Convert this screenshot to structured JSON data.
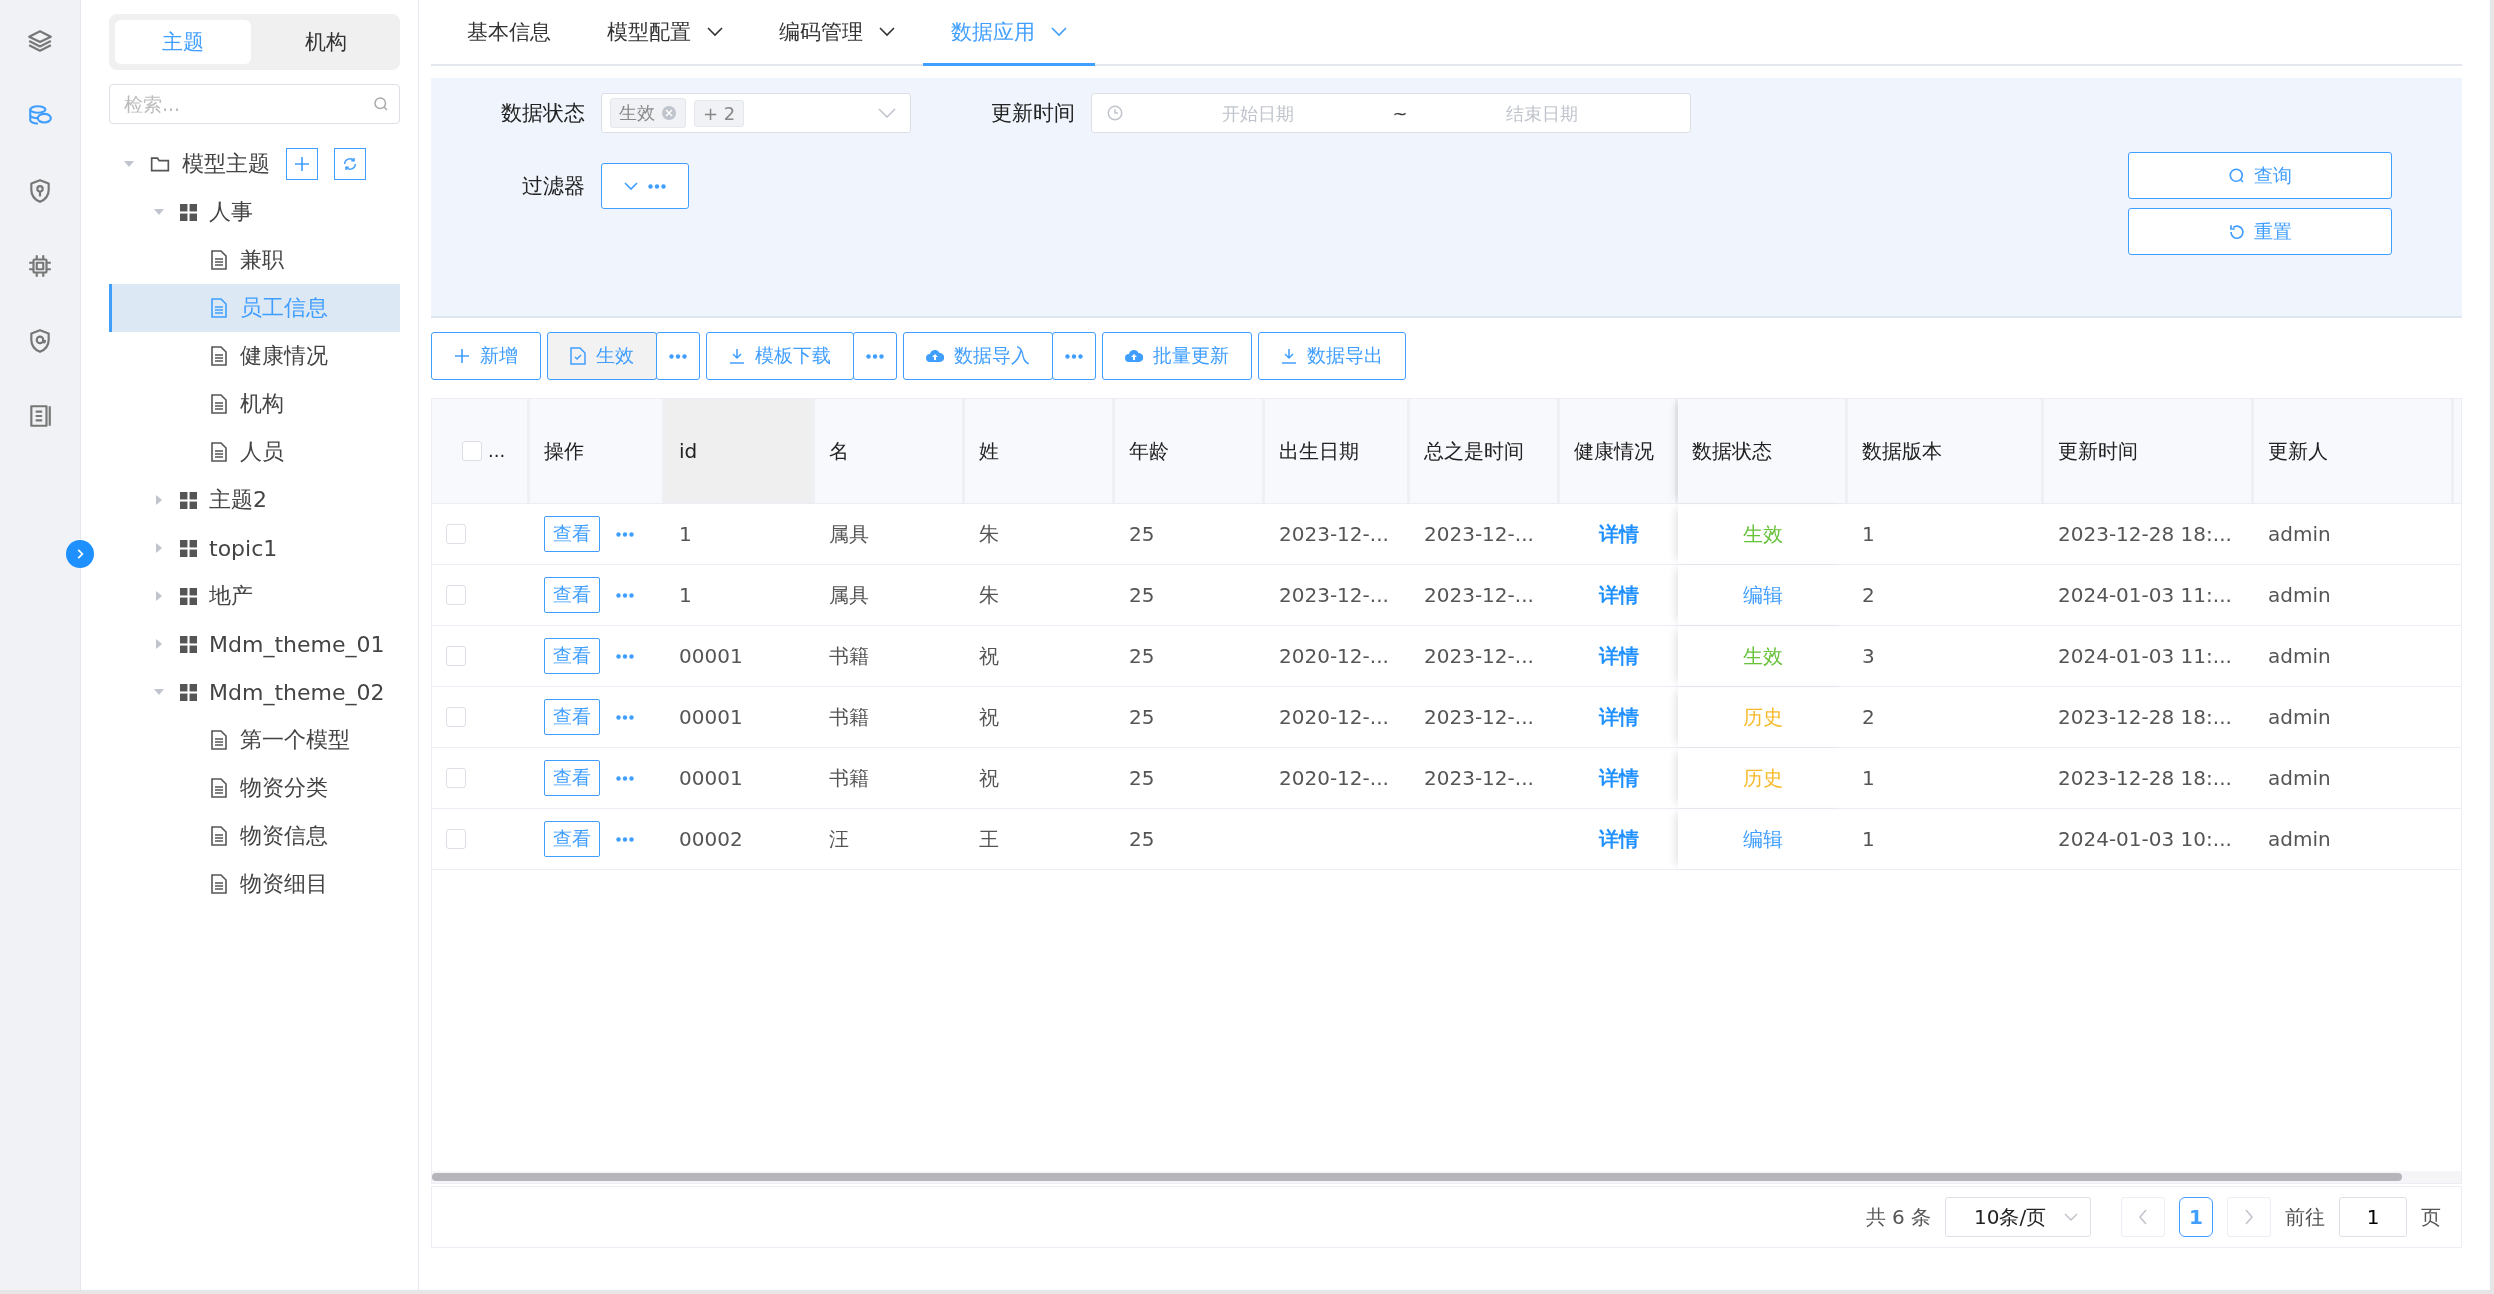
{
  "rail": [
    {
      "kind": "layers",
      "selected": false
    },
    {
      "kind": "database",
      "selected": true
    },
    {
      "kind": "shield-key",
      "selected": false
    },
    {
      "kind": "chip",
      "selected": false
    },
    {
      "kind": "shield-at",
      "selected": false
    },
    {
      "kind": "list",
      "selected": false
    }
  ],
  "tree_tabs": [
    {
      "label": "主题",
      "selected": true
    },
    {
      "label": "机构",
      "selected": false
    }
  ],
  "tree_search": {
    "placeholder": "检索..."
  },
  "tree": [
    {
      "label": "模型主题",
      "kind": "folder",
      "expanded": true,
      "selected": false,
      "children": [
        {
          "label": "人事",
          "kind": "group",
          "expanded": true,
          "selected": false,
          "children": [
            {
              "label": "兼职",
              "kind": "doc",
              "selected": false
            },
            {
              "label": "员工信息",
              "kind": "doc",
              "selected": true
            },
            {
              "label": "健康情况",
              "kind": "doc",
              "selected": false
            },
            {
              "label": "机构",
              "kind": "doc",
              "selected": false
            },
            {
              "label": "人员",
              "kind": "doc",
              "selected": false
            }
          ]
        },
        {
          "label": "主题2",
          "kind": "group",
          "expanded": false,
          "selected": false
        },
        {
          "label": "topic1",
          "kind": "group",
          "expanded": false,
          "selected": false
        },
        {
          "label": "地产",
          "kind": "group",
          "expanded": false,
          "selected": false
        },
        {
          "label": "Mdm_theme_01",
          "kind": "group",
          "expanded": false,
          "selected": false
        },
        {
          "label": "Mdm_theme_02",
          "kind": "group",
          "expanded": true,
          "selected": false,
          "children": [
            {
              "label": "第一个模型",
              "kind": "doc",
              "selected": false
            },
            {
              "label": "物资分类",
              "kind": "doc",
              "selected": false
            },
            {
              "label": "物资信息",
              "kind": "doc",
              "selected": false
            },
            {
              "label": "物资细目",
              "kind": "doc",
              "selected": false
            }
          ]
        }
      ]
    }
  ],
  "tabs": [
    {
      "label": "基本信息",
      "dropdown": false,
      "selected": false
    },
    {
      "label": "模型配置",
      "dropdown": true,
      "selected": false
    },
    {
      "label": "编码管理",
      "dropdown": true,
      "selected": false
    },
    {
      "label": "数据应用",
      "dropdown": true,
      "selected": true
    }
  ],
  "filters": {
    "status_label": "数据状态",
    "status_tags": [
      {
        "text": "生效",
        "closable": true
      },
      {
        "text": "+ 2",
        "closable": false
      }
    ],
    "time_label": "更新时间",
    "start_placeholder": "开始日期",
    "range_separator": "~",
    "end_placeholder": "结束日期",
    "filter_label": "过滤器",
    "query": "查询",
    "reset": "重置"
  },
  "toolbar": [
    {
      "kind": "add",
      "label": "新增",
      "more": false,
      "pressed": false
    },
    {
      "kind": "activate",
      "label": "生效",
      "more": true,
      "pressed": true
    },
    {
      "kind": "download",
      "label": "模板下载",
      "more": true,
      "pressed": false
    },
    {
      "kind": "upload",
      "label": "数据导入",
      "more": true,
      "pressed": false
    },
    {
      "kind": "upload",
      "label": "批量更新",
      "more": false,
      "pressed": false
    },
    {
      "kind": "download",
      "label": "数据导出",
      "more": false,
      "pressed": false
    }
  ],
  "table": {
    "select_all": {
      "checked": false,
      "label": "..."
    },
    "columns": [
      {
        "label": "操作",
        "highlighted": false
      },
      {
        "label": "id",
        "highlighted": true
      },
      {
        "label": "名",
        "highlighted": false
      },
      {
        "label": "姓",
        "highlighted": false
      },
      {
        "label": "年龄",
        "highlighted": false
      },
      {
        "label": "出生日期",
        "highlighted": false
      },
      {
        "label": "总之是时间",
        "highlighted": false
      },
      {
        "label": "健康情况",
        "highlighted": false
      },
      {
        "label": "数据状态",
        "highlighted": false
      },
      {
        "label": "数据版本",
        "highlighted": false
      },
      {
        "label": "更新时间",
        "highlighted": false
      },
      {
        "label": "更新人",
        "highlighted": false
      }
    ],
    "rows": [
      {
        "checked": false,
        "action": "查看",
        "id": "1",
        "name": "属具",
        "surname": "朱",
        "age": "25",
        "birth": "2023-12-...",
        "total_time": "2023-12-...",
        "health": "详情",
        "status": {
          "text": "生效",
          "color": "#67c23a"
        },
        "version": "1",
        "updated": "2023-12-28 18:...",
        "updater": "admin"
      },
      {
        "checked": false,
        "action": "查看",
        "id": "1",
        "name": "属具",
        "surname": "朱",
        "age": "25",
        "birth": "2023-12-...",
        "total_time": "2023-12-...",
        "health": "详情",
        "status": {
          "text": "编辑",
          "color": "#409eff"
        },
        "version": "2",
        "updated": "2024-01-03 11:...",
        "updater": "admin"
      },
      {
        "checked": false,
        "action": "查看",
        "id": "00001",
        "name": "书籍",
        "surname": "祝",
        "age": "25",
        "birth": "2020-12-...",
        "total_time": "2023-12-...",
        "health": "详情",
        "status": {
          "text": "生效",
          "color": "#67c23a"
        },
        "version": "3",
        "updated": "2024-01-03 11:...",
        "updater": "admin"
      },
      {
        "checked": false,
        "action": "查看",
        "id": "00001",
        "name": "书籍",
        "surname": "祝",
        "age": "25",
        "birth": "2020-12-...",
        "total_time": "2023-12-...",
        "health": "详情",
        "status": {
          "text": "历史",
          "color": "#f7ba2a"
        },
        "version": "2",
        "updated": "2023-12-28 18:...",
        "updater": "admin"
      },
      {
        "checked": false,
        "action": "查看",
        "id": "00001",
        "name": "书籍",
        "surname": "祝",
        "age": "25",
        "birth": "2020-12-...",
        "total_time": "2023-12-...",
        "health": "详情",
        "status": {
          "text": "历史",
          "color": "#f7ba2a"
        },
        "version": "1",
        "updated": "2023-12-28 18:...",
        "updater": "admin"
      },
      {
        "checked": false,
        "action": "查看",
        "id": "00002",
        "name": "汪",
        "surname": "王",
        "age": "25",
        "health": "详情",
        "status": {
          "text": "编辑",
          "color": "#409eff"
        },
        "version": "1",
        "updated": "2024-01-03 10:...",
        "updater": "admin"
      }
    ]
  },
  "pagination": {
    "total": "共 6 条",
    "page_size": "10条/页",
    "pages": [
      {
        "label": "1",
        "selected": true
      }
    ],
    "goto_label": "前往",
    "goto_value": "1",
    "page_suffix": "页"
  }
}
